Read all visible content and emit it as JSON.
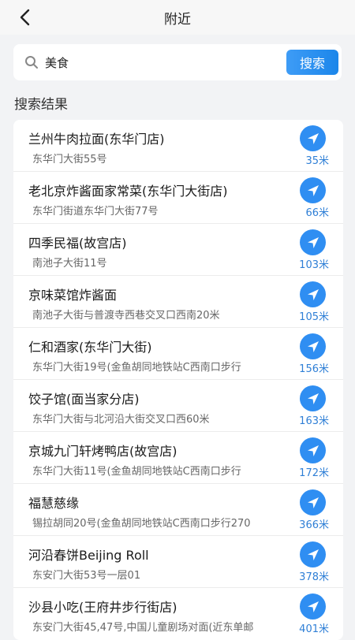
{
  "header": {
    "title": "附近"
  },
  "search": {
    "value": "美食",
    "button_label": "搜索"
  },
  "results": {
    "title": "搜索结果",
    "items": [
      {
        "name": "兰州牛肉拉面(东华门店)",
        "address": "东华门大街55号",
        "distance": "35米"
      },
      {
        "name": "老北京炸酱面家常菜(东华门大街店)",
        "address": "东华门街道东华门大街77号",
        "distance": "66米"
      },
      {
        "name": "四季民福(故宫店)",
        "address": "南池子大街11号",
        "distance": "103米"
      },
      {
        "name": "京味菜馆炸酱面",
        "address": "南池子大街与普渡寺西巷交叉口西南20米",
        "distance": "105米"
      },
      {
        "name": "仁和酒家(东华门大街)",
        "address": "东华门大街19号(金鱼胡同地铁站C西南口步行",
        "distance": "156米"
      },
      {
        "name": "饺子馆(面当家分店)",
        "address": "东华门大街与北河沿大街交叉口西60米",
        "distance": "163米"
      },
      {
        "name": "京城九门轩烤鸭店(故宫店)",
        "address": "东华门大街11号(金鱼胡同地铁站C西南口步行",
        "distance": "172米"
      },
      {
        "name": "福慧慈缘",
        "address": "锡拉胡同20号(金鱼胡同地铁站C西南口步行270",
        "distance": "366米"
      },
      {
        "name": "河沿春饼Beijing Roll",
        "address": "东安门大街53号一层01",
        "distance": "378米"
      },
      {
        "name": "沙县小吃(王府井步行街店)",
        "address": "东安门大街45,47号,中国儿童剧场对面(近东单邮",
        "distance": "401米"
      }
    ]
  },
  "icons": {
    "back": "chevron-left-icon",
    "search": "magnifier-icon",
    "navigate": "navigation-arrow-icon"
  },
  "colors": {
    "accent": "#2f8ef2",
    "distance": "#2f7fd6",
    "background": "#f2f3f5"
  }
}
